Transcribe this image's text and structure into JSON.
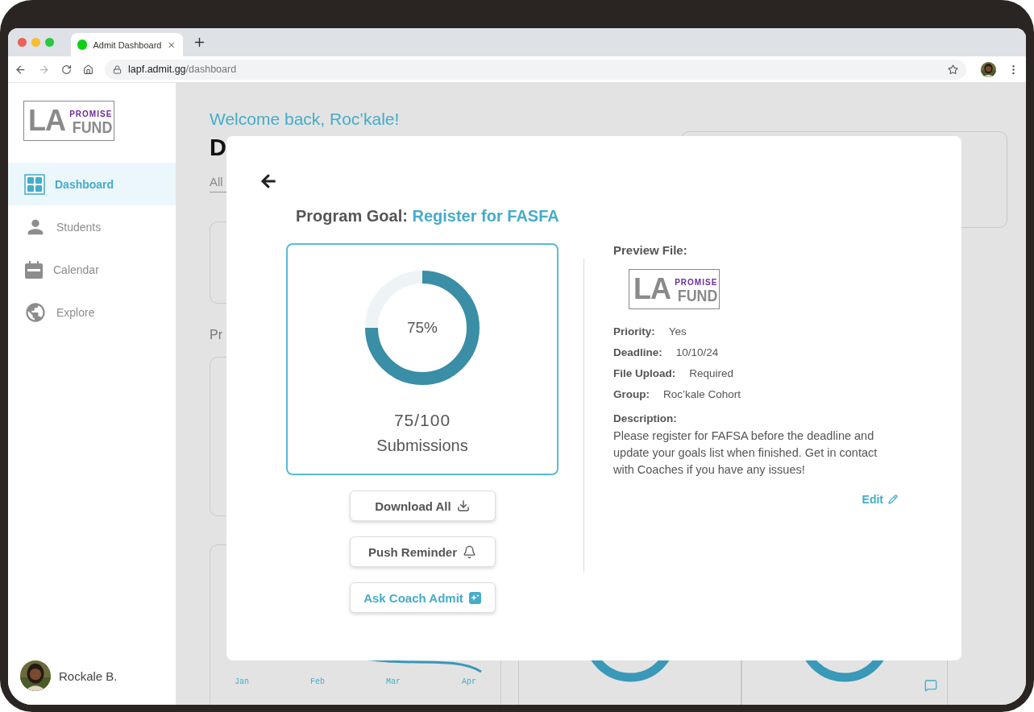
{
  "browser": {
    "tab_title": "Admit Dashboard",
    "url_host": "lapf.admit.gg",
    "url_path": "/dashboard",
    "forward_disabled": true
  },
  "sidebar": {
    "logo": {
      "big": "LA",
      "small": "PROMISE",
      "word": "FUND"
    },
    "items": [
      {
        "label": "Dashboard",
        "selected": true
      },
      {
        "label": "Students",
        "selected": false
      },
      {
        "label": "Calendar",
        "selected": false
      },
      {
        "label": "Explore",
        "selected": false
      }
    ],
    "user": {
      "name": "Rockale B."
    }
  },
  "dashboard": {
    "welcome": "Welcome back, Roc’kale!",
    "heading": "D",
    "filter_tab": "All",
    "section_label": "Pr",
    "chart_months": [
      "Jan",
      "Feb",
      "Mar",
      "Apr"
    ]
  },
  "modal": {
    "title_label": "Program Goal:",
    "title_value": "Register for FASFA",
    "progress": {
      "level": 0.75,
      "percent": "75%",
      "count": "75/100",
      "caption": "Submissions"
    },
    "buttons": [
      {
        "label": "Download All",
        "kind": "download"
      },
      {
        "label": "Push Reminder",
        "kind": "reminder"
      },
      {
        "label": "Ask Coach Admit",
        "kind": "assistant"
      }
    ],
    "preview": {
      "heading": "Preview File:",
      "logo": {
        "big": "LA",
        "small": "PROMISE",
        "word": "FUND"
      },
      "fields": [
        {
          "label": "Priority:",
          "value": "Yes"
        },
        {
          "label": "Deadline:",
          "value": "10/10/24"
        },
        {
          "label": "File Upload:",
          "value": "Required"
        },
        {
          "label": "Group:",
          "value": "Roc’kale Cohort"
        }
      ],
      "description_label": "Description:",
      "description": "Please register for FAFSA before the deadline and update your goals list when finished. Get in contact with Coaches if you have any issues!",
      "edit": "Edit"
    }
  }
}
